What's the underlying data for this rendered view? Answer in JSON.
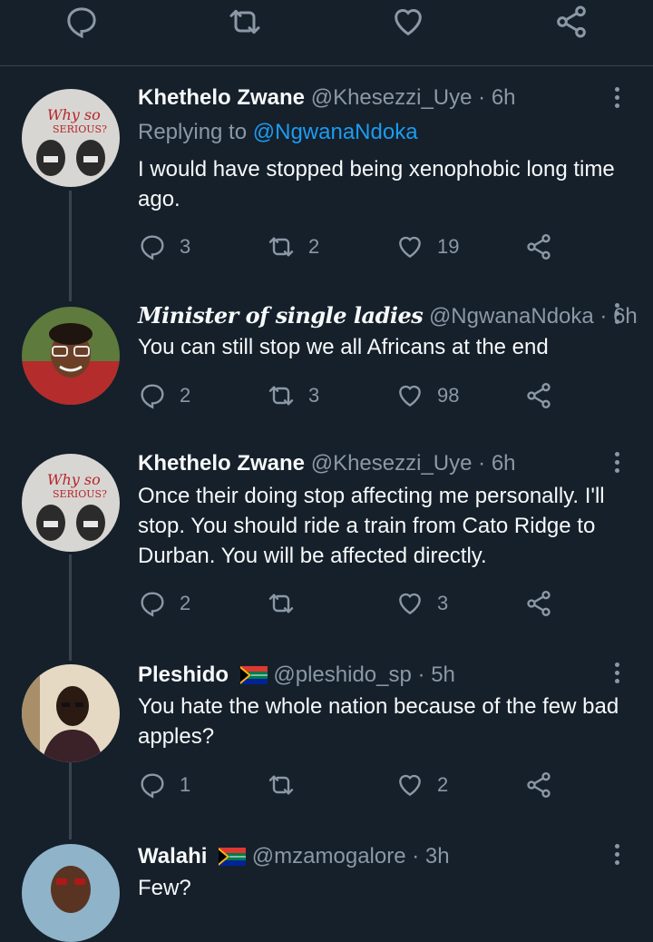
{
  "colors": {
    "background": "#15202b",
    "muted": "#8b98a5",
    "link": "#1d9bf0",
    "text": "#f7f9f9",
    "divider": "#38444d"
  },
  "top_actions": [
    {
      "icon": "comment-icon"
    },
    {
      "icon": "retweet-icon"
    },
    {
      "icon": "heart-icon"
    },
    {
      "icon": "share-icon"
    }
  ],
  "tweets": [
    {
      "name": "Khethelo Zwane",
      "handle": "@Khesezzi_Uye",
      "dot": "·",
      "time": "6h",
      "reply_prefix": "Replying to",
      "reply_handle": "@NgwanaNdoka",
      "text": "I would have stopped being xenophobic long time ago.",
      "replies": "3",
      "retweets": "2",
      "likes": "19"
    },
    {
      "name": "Minister of single ladies",
      "handle": "@NgwanaNdoka",
      "dot": "·",
      "time": "6h",
      "text": "You can still stop we all Africans at the end",
      "replies": "2",
      "retweets": "3",
      "likes": "98"
    },
    {
      "name": "Khethelo Zwane",
      "handle": "@Khesezzi_Uye",
      "dot": "·",
      "time": "6h",
      "text": "Once their doing stop affecting me personally. I'll stop. You should ride a train from Cato Ridge to Durban. You will be affected directly.",
      "replies": "2",
      "retweets": "",
      "likes": "3"
    },
    {
      "name": "Pleshido",
      "handle": "@pleshido_sp",
      "dot": "·",
      "time": "5h",
      "text": "You hate the whole nation because of the few bad apples?",
      "replies": "1",
      "retweets": "",
      "likes": "2"
    },
    {
      "name": "Walahi",
      "handle": "@mzamogalore",
      "dot": "·",
      "time": "3h",
      "text": "Few?"
    }
  ]
}
